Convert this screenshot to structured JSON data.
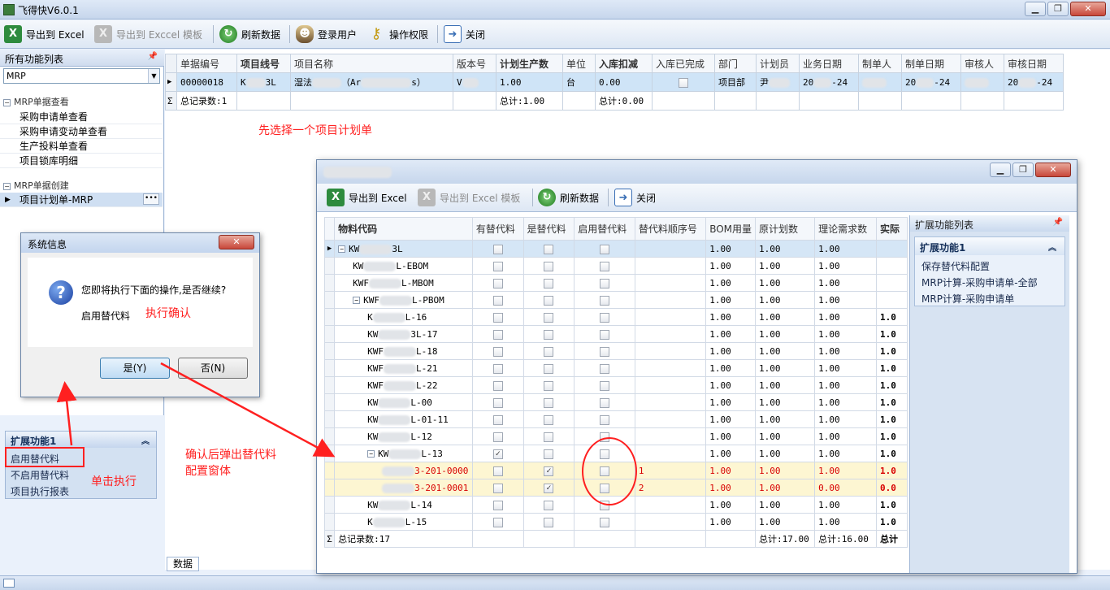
{
  "app": {
    "title": "飞得快V6.0.1"
  },
  "toolbar": {
    "export_excel": "导出到 Excel",
    "export_template": "导出到 Exccel 模板",
    "refresh": "刷新数据",
    "login_user": "登录用户",
    "permissions": "操作权限",
    "close": "关闭"
  },
  "left": {
    "header": "所有功能列表",
    "combo_value": "MRP",
    "group1": "MRP单据查看",
    "items1": [
      "采购申请单查看",
      "采购申请变动单查看",
      "生产投料单查看",
      "项目锁库明细"
    ],
    "group2": "MRP单据创建",
    "items2": [
      "项目计划单-MRP"
    ],
    "ext_header": "扩展功能1",
    "ext_items": [
      "启用替代料",
      "不启用替代料",
      "项目执行报表"
    ],
    "bottom_tab": "数据"
  },
  "grid1": {
    "headers": [
      "单据编号",
      "项目线号",
      "项目名称",
      "版本号",
      "计划生产数",
      "单位",
      "入库扣减",
      "入库已完成",
      "部门",
      "计划员",
      "业务日期",
      "制单人",
      "制单日期",
      "审核人",
      "审核日期"
    ],
    "row": {
      "doc_no": "00000018",
      "line_no": "K",
      "line_no_tail": "3L",
      "name": "湿法",
      "name_mid": "（Ar",
      "name_tail": "s）",
      "version": "V",
      "plan_qty": "1.00",
      "unit": "台",
      "deduct": "0.00",
      "dept": "项目部",
      "planner": "尹",
      "biz_date_a": "20",
      "biz_date_b": "-24",
      "make_date_a": "20",
      "make_date_b": "-24",
      "audit_date_a": "20",
      "audit_date_b": "-24"
    },
    "summary": {
      "count": "总记录数:1",
      "plan_total": "总计:1.00",
      "deduct_total": "总计:0.00"
    }
  },
  "annotations": {
    "select_hint": "先选择一个项目计划单",
    "confirm": "执行确认",
    "click_exec": "单击执行",
    "popup": "确认后弹出替代料\n配置窗体"
  },
  "dialog": {
    "title": "系统信息",
    "message": "您即将执行下面的操作,是否继续?",
    "action": "启用替代料",
    "yes": "是(Y)",
    "no": "否(N)"
  },
  "sub": {
    "toolbar": {
      "export_excel": "导出到 Excel",
      "export_template": "导出到 Excel 模板",
      "refresh": "刷新数据",
      "close": "关闭"
    },
    "headers": [
      "物料代码",
      "有替代料",
      "是替代料",
      "启用替代料",
      "替代料顺序号",
      "BOM用量",
      "原计划数",
      "理论需求数",
      "实际"
    ],
    "rows": [
      {
        "code_a": "KW",
        "code_b": "3L",
        "level": 0,
        "expander": "−",
        "has": false,
        "is": false,
        "enable": false,
        "seq": "",
        "bom": "1.00",
        "orig": "1.00",
        "need": "1.00",
        "act": "",
        "style": "sel"
      },
      {
        "code_a": "KW",
        "code_b": "L-EBOM",
        "level": 1,
        "expander": "",
        "has": false,
        "is": false,
        "enable": false,
        "seq": "",
        "bom": "1.00",
        "orig": "1.00",
        "need": "1.00",
        "act": "",
        "style": ""
      },
      {
        "code_a": "KWF",
        "code_b": "L-MBOM",
        "level": 1,
        "expander": "",
        "has": false,
        "is": false,
        "enable": false,
        "seq": "",
        "bom": "1.00",
        "orig": "1.00",
        "need": "1.00",
        "act": "",
        "style": ""
      },
      {
        "code_a": "KWF",
        "code_b": "L-PBOM",
        "level": 1,
        "expander": "−",
        "has": false,
        "is": false,
        "enable": false,
        "seq": "",
        "bom": "1.00",
        "orig": "1.00",
        "need": "1.00",
        "act": "",
        "style": ""
      },
      {
        "code_a": "K",
        "code_b": "L-16",
        "level": 2,
        "expander": "",
        "has": false,
        "is": false,
        "enable": false,
        "seq": "",
        "bom": "1.00",
        "orig": "1.00",
        "need": "1.00",
        "act": "1.0",
        "style": ""
      },
      {
        "code_a": "KW",
        "code_b": "3L-17",
        "level": 2,
        "expander": "",
        "has": false,
        "is": false,
        "enable": false,
        "seq": "",
        "bom": "1.00",
        "orig": "1.00",
        "need": "1.00",
        "act": "1.0",
        "style": ""
      },
      {
        "code_a": "KWF",
        "code_b": "L-18",
        "level": 2,
        "expander": "",
        "has": false,
        "is": false,
        "enable": false,
        "seq": "",
        "bom": "1.00",
        "orig": "1.00",
        "need": "1.00",
        "act": "1.0",
        "style": ""
      },
      {
        "code_a": "KWF",
        "code_b": "L-21",
        "level": 2,
        "expander": "",
        "has": false,
        "is": false,
        "enable": false,
        "seq": "",
        "bom": "1.00",
        "orig": "1.00",
        "need": "1.00",
        "act": "1.0",
        "style": ""
      },
      {
        "code_a": "KWF",
        "code_b": "L-22",
        "level": 2,
        "expander": "",
        "has": false,
        "is": false,
        "enable": false,
        "seq": "",
        "bom": "1.00",
        "orig": "1.00",
        "need": "1.00",
        "act": "1.0",
        "style": ""
      },
      {
        "code_a": "KW",
        "code_b": "L-00",
        "level": 2,
        "expander": "",
        "has": false,
        "is": false,
        "enable": false,
        "seq": "",
        "bom": "1.00",
        "orig": "1.00",
        "need": "1.00",
        "act": "1.0",
        "style": ""
      },
      {
        "code_a": "KW",
        "code_b": "L-01-11",
        "level": 2,
        "expander": "",
        "has": false,
        "is": false,
        "enable": false,
        "seq": "",
        "bom": "1.00",
        "orig": "1.00",
        "need": "1.00",
        "act": "1.0",
        "style": ""
      },
      {
        "code_a": "KW",
        "code_b": "L-12",
        "level": 2,
        "expander": "",
        "has": false,
        "is": false,
        "enable": false,
        "seq": "",
        "bom": "1.00",
        "orig": "1.00",
        "need": "1.00",
        "act": "1.0",
        "style": ""
      },
      {
        "code_a": "KW",
        "code_b": "L-13",
        "level": 2,
        "expander": "−",
        "has": true,
        "is": false,
        "enable": false,
        "seq": "",
        "bom": "1.00",
        "orig": "1.00",
        "need": "1.00",
        "act": "1.0",
        "style": ""
      },
      {
        "code_a": "",
        "code_b": "3-201-0000",
        "level": 3,
        "expander": "",
        "has": false,
        "is": true,
        "enable": false,
        "seq": "1",
        "bom": "1.00",
        "orig": "1.00",
        "need": "1.00",
        "act": "1.0",
        "style": "hl"
      },
      {
        "code_a": "",
        "code_b": "3-201-0001",
        "level": 3,
        "expander": "",
        "has": false,
        "is": true,
        "enable": false,
        "seq": "2",
        "bom": "1.00",
        "orig": "1.00",
        "need": "0.00",
        "act": "0.0",
        "style": "hl"
      },
      {
        "code_a": "KW",
        "code_b": "L-14",
        "level": 2,
        "expander": "",
        "has": false,
        "is": false,
        "enable": false,
        "seq": "",
        "bom": "1.00",
        "orig": "1.00",
        "need": "1.00",
        "act": "1.0",
        "style": ""
      },
      {
        "code_a": "K",
        "code_b": "L-15",
        "level": 2,
        "expander": "",
        "has": false,
        "is": false,
        "enable": false,
        "seq": "",
        "bom": "1.00",
        "orig": "1.00",
        "need": "1.00",
        "act": "1.0",
        "style": ""
      }
    ],
    "summary": {
      "count": "总记录数:17",
      "orig_total": "总计:17.00",
      "need_total": "总计:16.00",
      "act_total": "总计"
    },
    "ext": {
      "header": "扩展功能列表",
      "box_title": "扩展功能1",
      "items": [
        "保存替代料配置",
        "MRP计算-采购申请单-全部",
        "MRP计算-采购申请单"
      ]
    }
  }
}
